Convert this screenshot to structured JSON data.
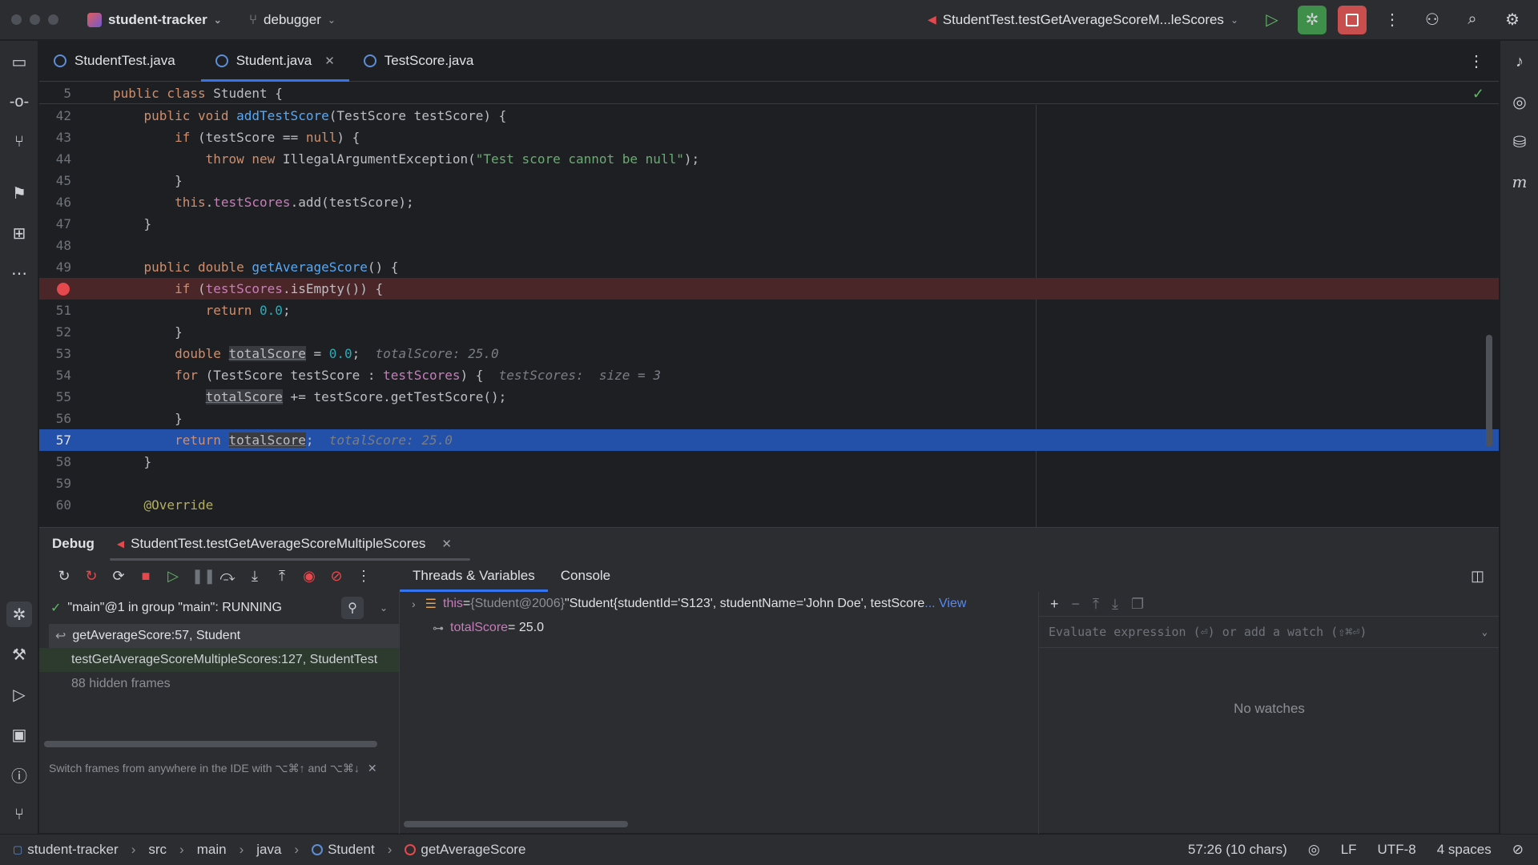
{
  "titlebar": {
    "project": "student-tracker",
    "branch": "debugger",
    "run_config": "StudentTest.testGetAverageScoreM...leScores"
  },
  "tabs": [
    {
      "label": "StudentTest.java"
    },
    {
      "label": "Student.java"
    },
    {
      "label": "TestScore.java"
    }
  ],
  "editor": {
    "lines": [
      {
        "n": "5"
      },
      {
        "n": "42"
      },
      {
        "n": "43"
      },
      {
        "n": "44"
      },
      {
        "n": "45"
      },
      {
        "n": "46"
      },
      {
        "n": "47"
      },
      {
        "n": "48"
      },
      {
        "n": "49"
      },
      {
        "n": "50"
      },
      {
        "n": "51"
      },
      {
        "n": "52"
      },
      {
        "n": "53"
      },
      {
        "n": "54"
      },
      {
        "n": "55"
      },
      {
        "n": "56"
      },
      {
        "n": "57"
      },
      {
        "n": "58"
      },
      {
        "n": "59"
      },
      {
        "n": "60"
      }
    ],
    "hints": {
      "h53": "totalScore: 25.0",
      "h54": "testScores:  size = 3",
      "h57": "totalScore: 25.0"
    }
  },
  "debug": {
    "title": "Debug",
    "session": "StudentTest.testGetAverageScoreMultipleScores",
    "tabs": [
      "Threads & Variables",
      "Console"
    ],
    "thread": "\"main\"@1 in group \"main\": RUNNING",
    "frames": [
      "getAverageScore:57, Student",
      "testGetAverageScoreMultipleScores:127, StudentTest",
      "88 hidden frames"
    ],
    "tip": "Switch frames from anywhere in the IDE with ⌥⌘↑ and ⌥⌘↓",
    "vars": {
      "this_name": "this",
      "this_eq": " = ",
      "this_ref": "{Student@2006}",
      "this_value": " \"Student{studentId='S123', studentName='John Doe', testScore",
      "this_link": "... View",
      "total_name": "totalScore",
      "total_value": " = 25.0"
    },
    "watch_placeholder": "Evaluate expression (⏎) or add a watch (⇧⌘⏎)",
    "no_watches": "No watches"
  },
  "statusbar": {
    "crumbs": [
      "student-tracker",
      "src",
      "main",
      "java",
      "Student",
      "getAverageScore"
    ],
    "position": "57:26 (10 chars)",
    "line_sep": "LF",
    "encoding": "UTF-8",
    "indent": "4 spaces"
  }
}
